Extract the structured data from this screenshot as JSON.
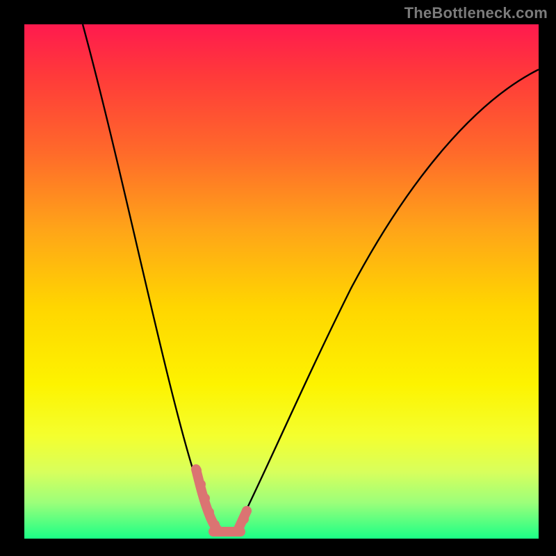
{
  "watermark": "TheBottleneck.com",
  "colors": {
    "black": "#000000",
    "curve": "#000000",
    "marker": "#db7472",
    "gradient_top": "#ff1a4e",
    "gradient_bottom": "#1bff86"
  },
  "chart_data": {
    "type": "line",
    "title": "",
    "xlabel": "",
    "ylabel": "",
    "xlim": [
      0,
      100
    ],
    "ylim": [
      0,
      100
    ],
    "note": "No axis tick labels are visible in the image; values below are estimated from the curve geometry relative to the plot rectangle (0–100 on each axis, y runs bottom-to-top). The curve is a V-shaped bottleneck profile reaching ~0 near x≈36–41, with a highlighted marker segment around the minimum.",
    "series": [
      {
        "name": "bottleneck-curve-left",
        "x": [
          11,
          14,
          17,
          20,
          23,
          26,
          29,
          31,
          33,
          35,
          37
        ],
        "y": [
          100,
          88,
          76,
          64,
          52,
          40,
          28,
          18,
          10,
          4,
          1
        ]
      },
      {
        "name": "bottleneck-curve-right",
        "x": [
          41,
          44,
          48,
          53,
          59,
          66,
          74,
          83,
          92,
          100
        ],
        "y": [
          1,
          5,
          12,
          22,
          34,
          47,
          60,
          72,
          82,
          90
        ]
      }
    ],
    "markers": {
      "name": "highlight-near-minimum",
      "color": "#db7472",
      "points": [
        {
          "x": 33,
          "y": 12
        },
        {
          "x": 34,
          "y": 8
        },
        {
          "x": 35,
          "y": 5
        },
        {
          "x": 36,
          "y": 2
        },
        {
          "x": 37,
          "y": 1
        },
        {
          "x": 38,
          "y": 1
        },
        {
          "x": 39,
          "y": 1
        },
        {
          "x": 40,
          "y": 1
        },
        {
          "x": 41,
          "y": 2
        },
        {
          "x": 42,
          "y": 4
        }
      ]
    }
  }
}
